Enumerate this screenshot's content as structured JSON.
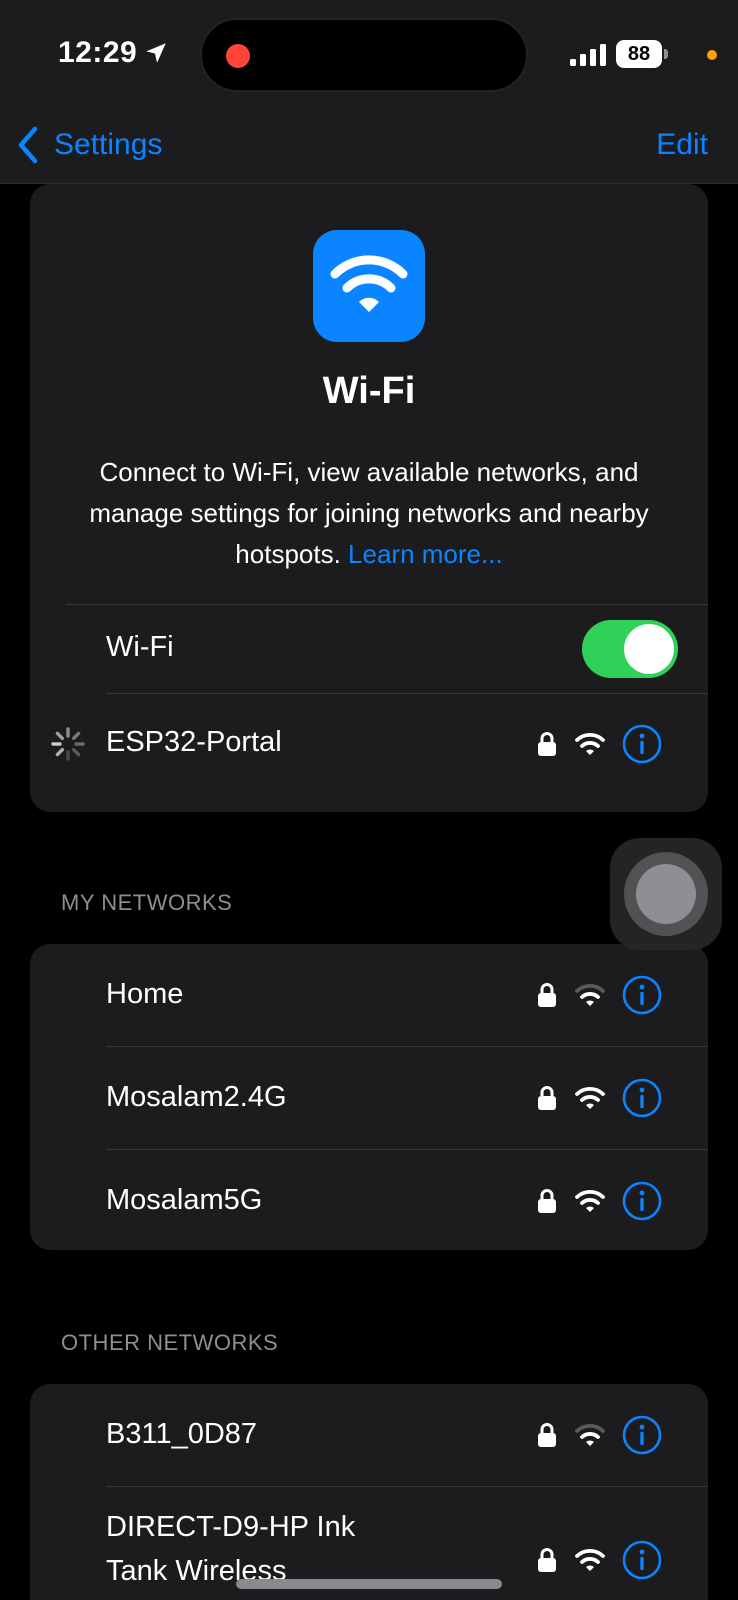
{
  "status_bar": {
    "time": "12:29",
    "battery": "88"
  },
  "nav": {
    "back_label": "Settings",
    "edit_label": "Edit"
  },
  "hero": {
    "title": "Wi-Fi",
    "description": "Connect to Wi-Fi, view available networks, and manage settings for joining networks and nearby hotspots.",
    "learn_more": "Learn more..."
  },
  "wifi_toggle": {
    "label": "Wi-Fi",
    "enabled": true
  },
  "current_network": {
    "name": "ESP32-Portal",
    "secured": true,
    "status": "connecting"
  },
  "my_networks": {
    "header": "MY NETWORKS",
    "items": [
      {
        "name": "Home",
        "secured": true,
        "signal": "weak"
      },
      {
        "name": "Mosalam2.4G",
        "secured": true,
        "signal": "strong"
      },
      {
        "name": "Mosalam5G",
        "secured": true,
        "signal": "strong"
      }
    ]
  },
  "other_networks": {
    "header": "OTHER NETWORKS",
    "items": [
      {
        "name": "B311_0D87",
        "secured": true,
        "signal": "weak"
      },
      {
        "name_line1": "DIRECT-D9-HP Ink",
        "name_line2": "Tank Wireless",
        "secured": true,
        "signal": "strong"
      }
    ]
  },
  "colors": {
    "accent": "#0a84ff",
    "toggle_on": "#30d158",
    "background": "#000000",
    "card": "#1c1c1e"
  }
}
